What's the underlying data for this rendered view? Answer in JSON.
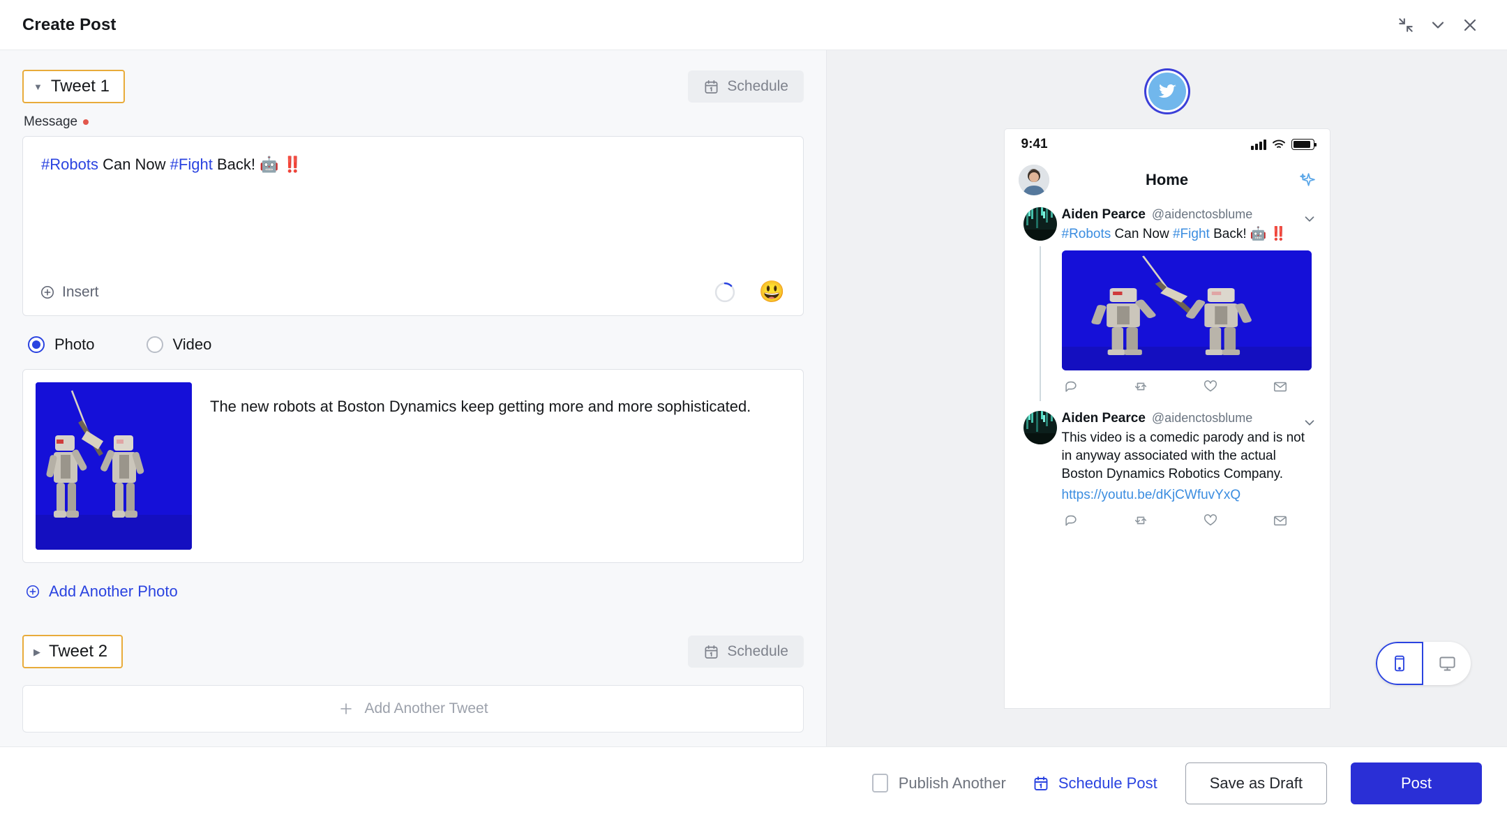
{
  "window": {
    "title": "Create Post",
    "controls": [
      {
        "name": "collapse-icon",
        "label": "Collapse"
      },
      {
        "name": "chevron-down-icon",
        "label": "Minimize"
      },
      {
        "name": "close-icon",
        "label": "Close"
      }
    ]
  },
  "editor": {
    "tweet1": {
      "label": "Tweet 1",
      "expanded": true,
      "caret": "▼",
      "schedule_label": "Schedule",
      "message_label": "Message",
      "message_required": true,
      "message_parts": [
        {
          "type": "hashtag",
          "text": "#Robots"
        },
        {
          "type": "text",
          "text": " Can Now "
        },
        {
          "type": "hashtag",
          "text": "#Fight"
        },
        {
          "type": "text",
          "text": " Back! 🤖 ‼️"
        }
      ],
      "message_plain": "#Robots Can Now #Fight Back! 🤖 ‼️",
      "insert_label": "Insert",
      "emoji_glyph": "😃",
      "counter_percent": 12
    },
    "media_type": {
      "options": [
        {
          "label": "Photo",
          "selected": true
        },
        {
          "label": "Video",
          "selected": false
        }
      ]
    },
    "media_card": {
      "caption": "The new robots at Boston Dynamics keep getting more and more sophisticated.",
      "thumb_bg": "#1510d8"
    },
    "add_photo_label": "Add Another Photo",
    "tweet2": {
      "label": "Tweet 2",
      "expanded": false,
      "caret": "▶",
      "schedule_label": "Schedule"
    },
    "add_tweet_label": "Add Another Tweet"
  },
  "preview": {
    "network": "twitter",
    "phone": {
      "status_time": "9:41",
      "header_title": "Home"
    },
    "tweets": [
      {
        "name": "Aiden Pearce",
        "handle": "@aidenctosblume",
        "text_parts": [
          {
            "type": "hashtag",
            "text": "#Robots"
          },
          {
            "type": "text",
            "text": " Can Now "
          },
          {
            "type": "hashtag",
            "text": "#Fight"
          },
          {
            "type": "text",
            "text": " Back! 🤖 ‼️"
          }
        ],
        "has_media": true
      },
      {
        "name": "Aiden Pearce",
        "handle": "@aidenctosblume",
        "text": "This video is a comedic parody and is not in anyway associated with the actual Boston Dynamics Robotics Company.",
        "link": "https://youtu.be/dKjCWfuvYxQ",
        "has_media": false
      }
    ],
    "actions": [
      "reply-icon",
      "retweet-icon",
      "like-icon",
      "message-icon"
    ],
    "device_toggle": [
      {
        "name": "mobile-device-icon",
        "active": true
      },
      {
        "name": "desktop-device-icon",
        "active": false
      }
    ]
  },
  "footer": {
    "publish_another_label": "Publish Another",
    "publish_another_checked": false,
    "schedule_post_label": "Schedule Post",
    "save_draft_label": "Save as Draft",
    "post_label": "Post"
  },
  "colors": {
    "accent_blue": "#2a43e0",
    "primary_button": "#2a2fd6",
    "highlight_orange": "#e8ab3a",
    "required_red": "#e2574c",
    "twitter_blue": "#71b7ec",
    "media_blue": "#1510d8"
  }
}
